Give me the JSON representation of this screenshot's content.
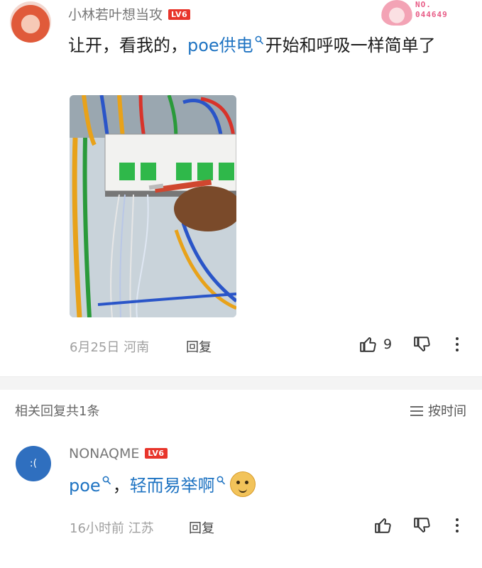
{
  "comment": {
    "username": "小林若叶想当攻",
    "level": "LV6",
    "badge_no_label": "NO.",
    "badge_no_value": "044649",
    "text_before": "让开，看我的，",
    "link_text": "poe供电",
    "text_after": "开始和呼吸一样简单了",
    "date": "6月25日",
    "location": "河南",
    "reply_label": "回复",
    "like_count": "9"
  },
  "related": {
    "title": "相关回复共1条",
    "sort_label": "按时间"
  },
  "sub_comment": {
    "avatar_text": ":(",
    "username": "NONAQME",
    "level": "LV6",
    "link1": "poe",
    "sep": "，",
    "link2": "轻而易举啊",
    "time": "16小时前",
    "location": "江苏",
    "reply_label": "回复"
  },
  "colors": {
    "link": "#1e73c2",
    "level_badge": "#e8352b",
    "sub_avatar": "#2f6fbf"
  },
  "icons": [
    "search-icon",
    "thumbs-up-icon",
    "thumbs-down-icon",
    "more-icon",
    "sort-icon",
    "doge-emoji-icon"
  ]
}
